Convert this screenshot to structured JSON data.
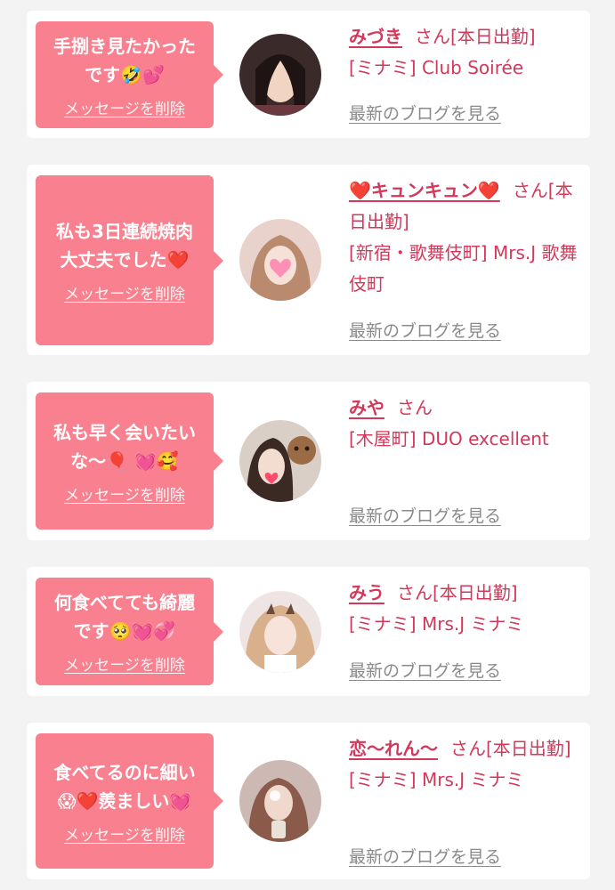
{
  "colors": {
    "background": "#f3f3f3",
    "card": "#ffffff",
    "bubble": "#f8808f",
    "name_text": "#d3385a",
    "link_gray": "#8a8a8a"
  },
  "items": [
    {
      "message": "手捌き見たかった\nです🤣💕",
      "delete_label": "メッセージを削除",
      "name": "みづき",
      "name_suffix": "さん[本日出勤]",
      "shop": "[ミナミ] Club Soirée",
      "blog_link": "最新のブログを見る",
      "avatar_icon": "profile-photo"
    },
    {
      "message": "私も3日連続焼肉\n大丈夫でした❤️",
      "delete_label": "メッセージを削除",
      "name": "❤️キュンキュン❤️",
      "name_suffix": "さん[本日出勤]",
      "shop": "[新宿・歌舞伎町] Mrs.J 歌舞伎町",
      "blog_link": "最新のブログを見る",
      "avatar_icon": "profile-photo"
    },
    {
      "message": "私も早く会いたい\nな〜🎈 💓🥰",
      "delete_label": "メッセージを削除",
      "name": "みや",
      "name_suffix": "さん",
      "shop": "[木屋町] DUO excellent",
      "blog_link": "最新のブログを見る",
      "avatar_icon": "profile-photo"
    },
    {
      "message": "何食べてても綺麗\nです🥺💓💞",
      "delete_label": "メッセージを削除",
      "name": "みう",
      "name_suffix": "さん[本日出勤]",
      "shop": "[ミナミ] Mrs.J ミナミ",
      "blog_link": "最新のブログを見る",
      "avatar_icon": "profile-photo"
    },
    {
      "message": "食べてるのに細い\n😱❤️羨ましい💓",
      "delete_label": "メッセージを削除",
      "name": "恋〜れん〜",
      "name_suffix": "さん[本日出勤]",
      "shop": "[ミナミ] Mrs.J ミナミ",
      "blog_link": "最新のブログを見る",
      "avatar_icon": "profile-photo"
    }
  ]
}
